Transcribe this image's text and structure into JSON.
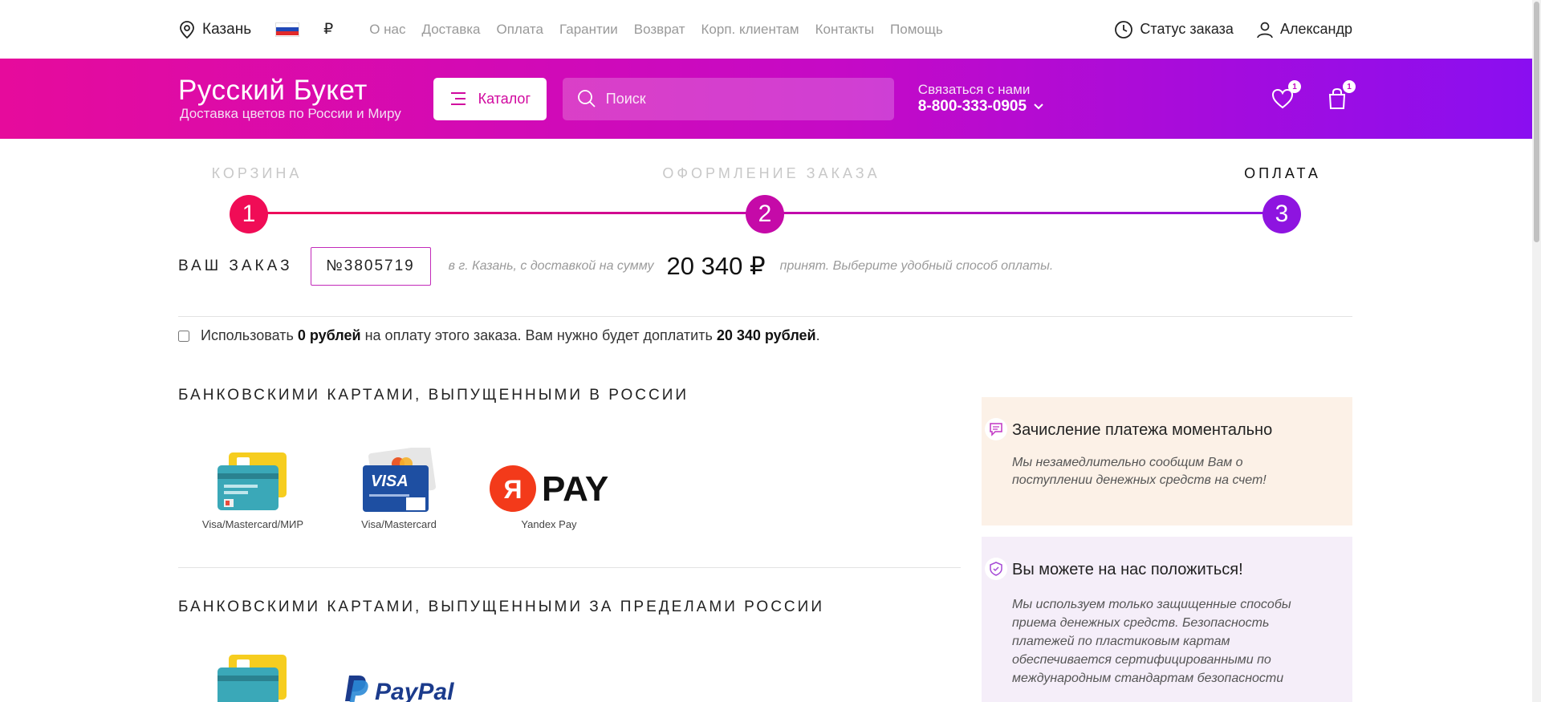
{
  "topbar": {
    "city": "Казань",
    "currency": "₽",
    "nav": [
      "О нас",
      "Доставка",
      "Оплата",
      "Гарантии",
      "Возврат",
      "Корп. клиентам",
      "Контакты",
      "Помощь"
    ],
    "order_status": "Статус заказа",
    "user": "Александр"
  },
  "header": {
    "logo_name": "Русский Букет",
    "logo_tagline": "Доставка цветов по России и Миру",
    "catalog_label": "Каталог",
    "search_placeholder": "Поиск",
    "contact_label": "Связаться с нами",
    "phone": "8-800-333-0905",
    "favorites_count": "1",
    "cart_count": "1"
  },
  "steps": [
    {
      "num": "1",
      "label": "КОРЗИНА",
      "active": false,
      "color": "#f00c56"
    },
    {
      "num": "2",
      "label": "ОФОРМЛЕНИЕ ЗАКАЗА",
      "active": false,
      "color": "#c50aa8"
    },
    {
      "num": "3",
      "label": "ОПЛАТА",
      "active": true,
      "color": "#8e14e0"
    }
  ],
  "order": {
    "title": "ВАШ ЗАКАЗ",
    "number": "№3805719",
    "city_text": "в г. Казань, с доставкой на сумму",
    "sum": "20 340 ₽",
    "accepted_text": "принят.  Выберите удобный способ оплаты."
  },
  "bonus": {
    "text_1": "Использовать",
    "amount": "0 рублей",
    "text_2": "на оплату этого заказа. Вам нужно будет доплатить",
    "pay_amount": "20 340 рублей",
    "text_3": "."
  },
  "sections": {
    "russia": "БАНКОВСКИМИ КАРТАМИ, ВЫПУЩЕННЫМИ В РОССИИ",
    "abroad": "БАНКОВСКИМИ КАРТАМИ, ВЫПУЩЕННЫМИ ЗА ПРЕДЕЛАМИ РОССИИ"
  },
  "methods_russia": [
    "Visa/Mastercard/МИР",
    "Visa/Mastercard",
    "Yandex Pay"
  ],
  "methods_abroad_logos": {
    "paypal": "PayPal",
    "yandex_letter": "Я",
    "yandex_pay": "PAY",
    "visa": "VISA"
  },
  "info": {
    "instant_title": "Зачисление платежа моментально",
    "instant_text": "Мы незамедлительно сообщим Вам о поступлении денежных средств на счет!",
    "trust_title": "Вы можете на нас положиться!",
    "trust_text": "Мы используем только защищенные способы приема денежных средств. Безопасность платежей по пластиковым картам обеспечивается сертифицированными по международным стандартам безопасности"
  },
  "colors": {
    "brand_pink": "#e60b9c",
    "brand_purple": "#8a0ef0"
  }
}
